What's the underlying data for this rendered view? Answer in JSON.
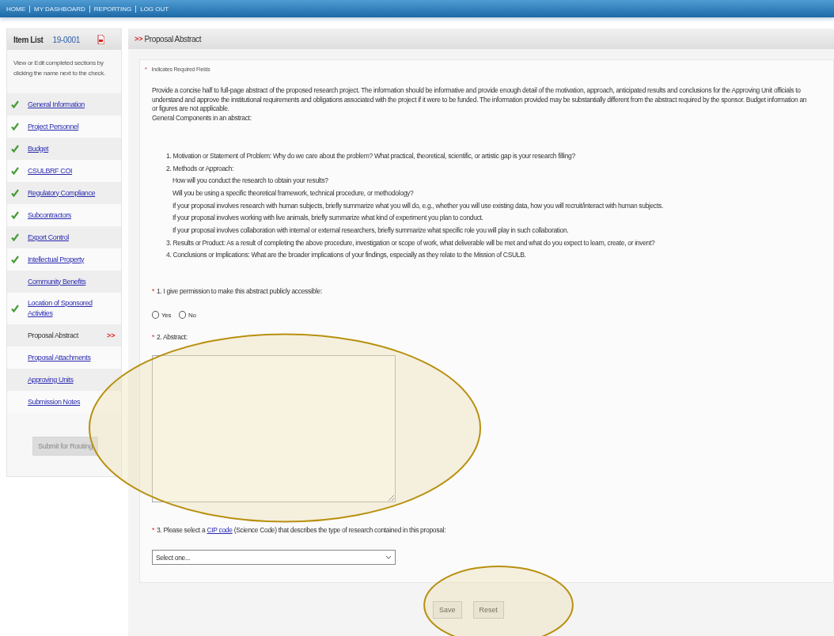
{
  "nav": [
    "HOME",
    "MY DASHBOARD",
    "REPORTING",
    "LOG OUT"
  ],
  "sidebar": {
    "title": "Item List",
    "number": "19-0001",
    "note": "View or Edit completed sections by clicking the name next to the check.",
    "items": [
      {
        "label": "General Information",
        "checked": true,
        "selected": false
      },
      {
        "label": "Project Personnel",
        "checked": true,
        "selected": false
      },
      {
        "label": "Budget",
        "checked": true,
        "selected": false
      },
      {
        "label": "CSULBRF COI",
        "checked": true,
        "selected": false
      },
      {
        "label": "Regulatory Compliance",
        "checked": true,
        "selected": false
      },
      {
        "label": "Subcontractors",
        "checked": true,
        "selected": false
      },
      {
        "label": "Export Control",
        "checked": true,
        "selected": false
      },
      {
        "label": "Intellectual Property",
        "checked": true,
        "selected": false
      },
      {
        "label": "Community Benefits",
        "checked": false,
        "selected": false
      },
      {
        "label": "Location of Sponsored Activities",
        "checked": true,
        "selected": false
      },
      {
        "label": "Proposal Abstract",
        "checked": false,
        "selected": true
      },
      {
        "label": "Proposal Attachments",
        "checked": false,
        "selected": false
      },
      {
        "label": "Approving Units",
        "checked": false,
        "selected": false
      },
      {
        "label": "Submission Notes",
        "checked": false,
        "selected": false
      }
    ],
    "submit": {
      "label": "Submit for Routing",
      "disabled": true
    }
  },
  "panel": {
    "marker": ">>",
    "title": "Proposal Abstract",
    "required_mark": "*",
    "required_note": "Indicates Required Fields",
    "intro_lines": [
      "Provide a concise half to full-page abstract of the proposed research project. The information should be informative and provide enough detail of the motivation, approach, anticipated results and conclusions for the Approving Unit officials to",
      "understand and approve the institutional requirements and obligations associated with the project if it were to be funded. The information provided may be substantially different from the abstract required by the sponsor. Budget information an",
      "or figures are not applicable.",
      "General Components in an abstract:"
    ],
    "components": [
      {
        "text": "1. Motivation or Statement of Problem: Why do we care about the problem? What practical, theoretical, scientific, or artistic gap is your research filling?"
      },
      {
        "text": "2. Methods or Approach:",
        "children": [
          "How will you conduct the research to obtain your results?",
          "Will you be using a specific theoretical framework, technical procedure, or methodology?",
          "If your proposal involves research with human subjects, briefly summarize what you will do, e.g., whether you will use existing data, how you will recruit/interact with human subjects.",
          "If your proposal involves working with live animals, briefly summarize what kind of experiment you plan to conduct.",
          "If your proposal involves collaboration with internal or external researchers, briefly summarize what specific role you will play in such collaboration."
        ]
      },
      {
        "text": "3. Results or Product: As a result of completing the above procedure, investigation or scope of work, what deliverable will be met and what do you expect to learn, create, or invent?"
      },
      {
        "text": "4. Conclusions or Implications: What are the broader implications of your findings, especially as they relate to the Mission of CSULB."
      }
    ],
    "q1": {
      "required_mark": "*",
      "label": "1. I give permission to make this abstract publicly accessible:",
      "options": [
        {
          "label": "Yes",
          "selected": false
        },
        {
          "label": "No",
          "selected": false
        }
      ]
    },
    "q2": {
      "required_mark": "*",
      "label": "2. Abstract:"
    },
    "q3": {
      "required_mark": "*",
      "before": "3. Please select a",
      "link": "CIP code",
      "after": "(Science Code) that describes the type of research contained in this proposal:",
      "select": "Select one..."
    },
    "buttons": [
      "Save",
      "Reset"
    ]
  },
  "highlights": [
    {
      "kind": "ellipse"
    },
    {
      "kind": "ellipse"
    }
  ]
}
